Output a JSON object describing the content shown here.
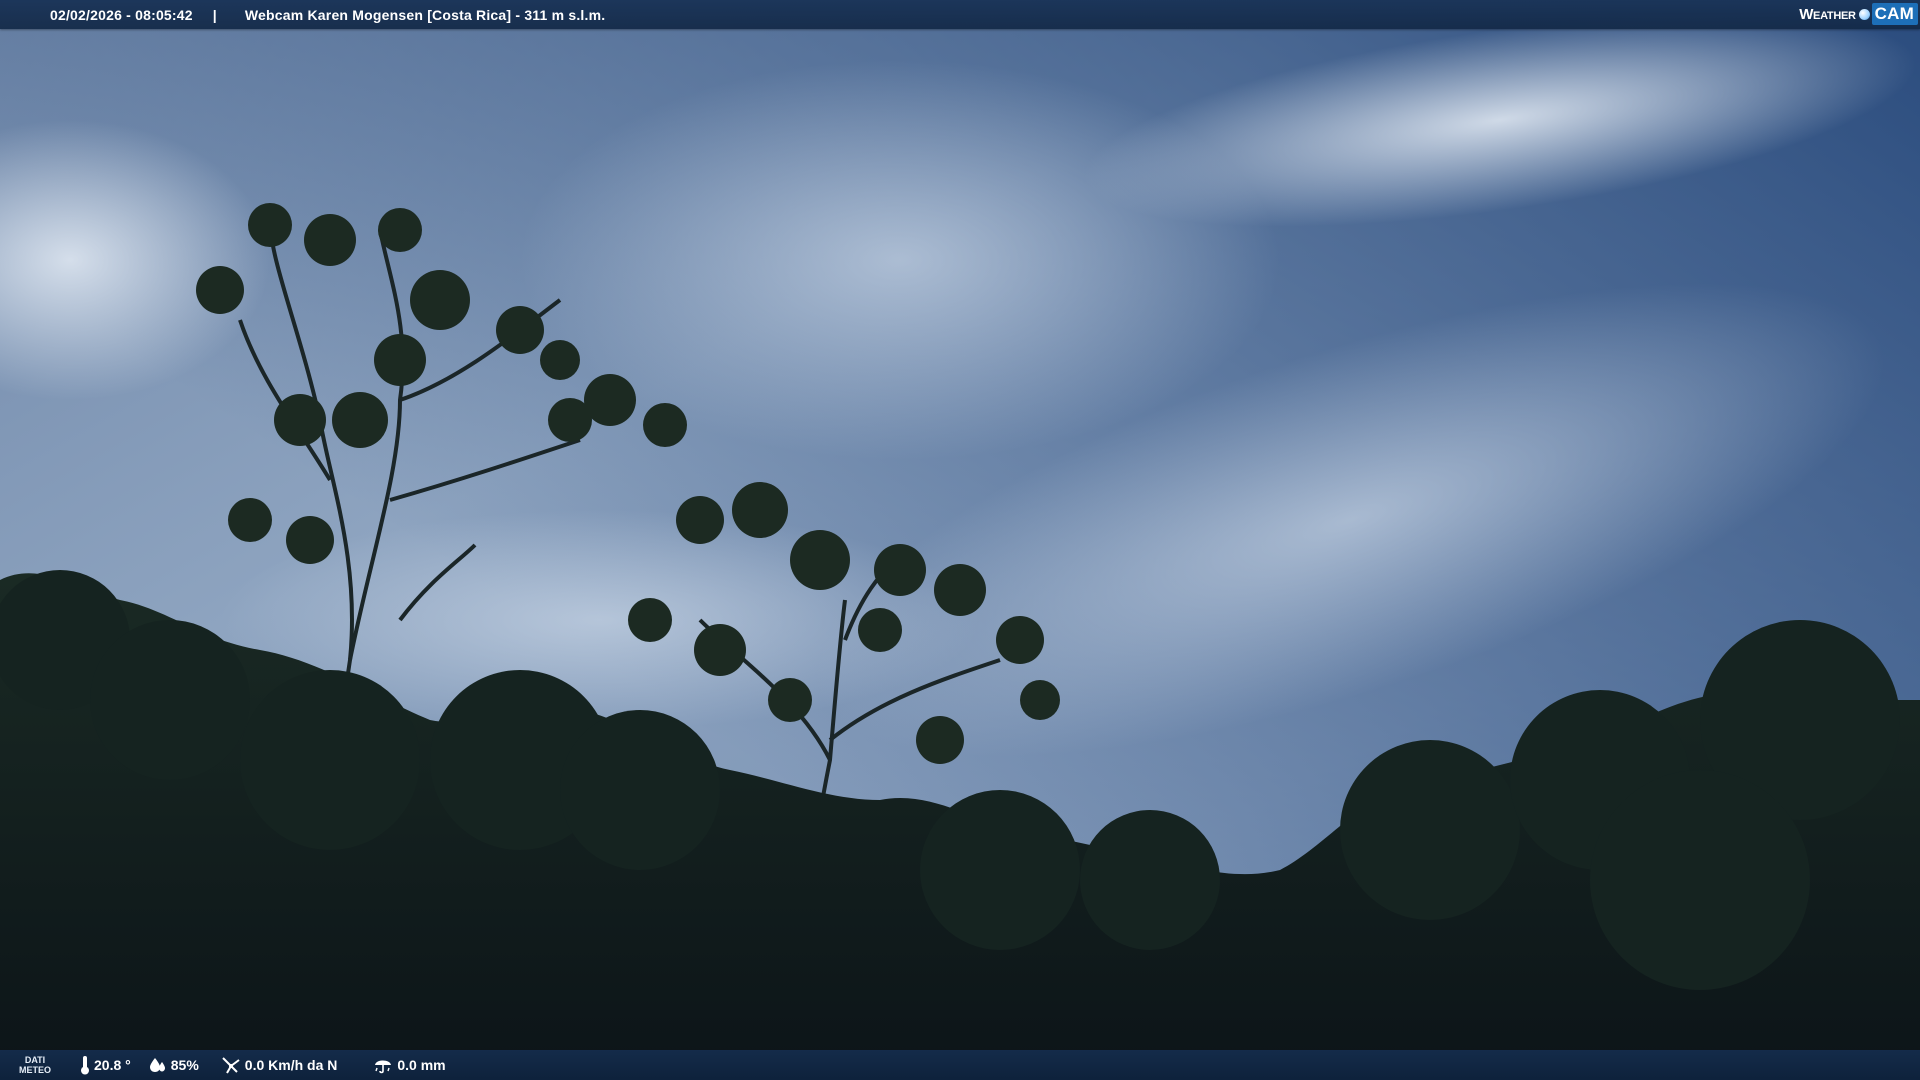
{
  "header": {
    "datetime": "02/02/2026 - 08:05:42",
    "separator": "|",
    "camera_title": "Webcam Karen Mogensen [Costa Rica] - 311 m s.l.m."
  },
  "logo": {
    "weather": "Weather",
    "cam": "CAM"
  },
  "weather_bar": {
    "label_line1": "DATI",
    "label_line2": "METEO",
    "temperature": "20.8 °",
    "humidity": "85%",
    "wind": "0.0 Km/h da N",
    "rain": "0.0 mm"
  },
  "colors": {
    "bar_background": "#16304f",
    "logo_accent": "#1d6fb8",
    "sky_top": "#2c4a78",
    "foliage": "#0f1a1e"
  },
  "icons": [
    "thermometer-icon",
    "humidity-drop-icon",
    "wind-icon",
    "rain-umbrella-icon"
  ]
}
